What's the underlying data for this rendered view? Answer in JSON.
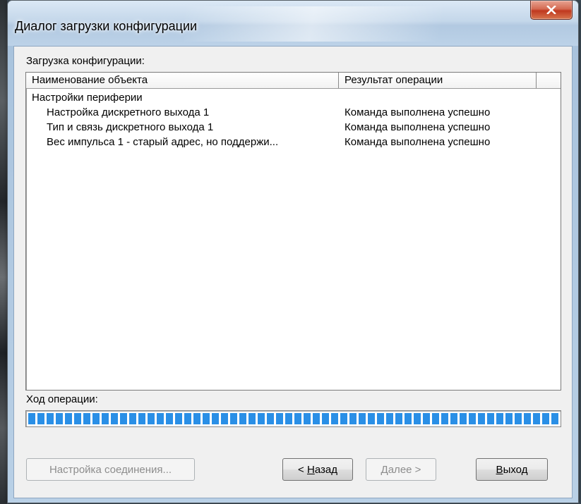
{
  "window": {
    "title": "Диалог загрузки конфигурации"
  },
  "upload_label": "Загрузка конфигурации:",
  "list": {
    "columns": [
      "Наименование объекта",
      "Результат операции",
      ""
    ],
    "rows": [
      {
        "name": "Настройки периферии",
        "result": ""
      },
      {
        "name": "Настройка дискретного выхода 1",
        "result": "Команда выполнена успешно"
      },
      {
        "name": "Тип и связь дискретного выхода 1",
        "result": "Команда выполнена успешно"
      },
      {
        "name": "Вес импульса 1 - старый адрес, но поддержи...",
        "result": "Команда выполнена успешно"
      }
    ]
  },
  "progress_label": "Ход операции:",
  "progress": {
    "value_percent": 100,
    "color": "#2a8fe6"
  },
  "buttons": {
    "connection_settings": "Настройка соединения...",
    "back_prefix": "< ",
    "back_mnemonic": "Н",
    "back_rest": "азад",
    "next_mnemonic": "Д",
    "next_rest": "алее >",
    "exit_mnemonic": "В",
    "exit_rest": "ыход"
  },
  "icons": {
    "close": "close-x-icon"
  }
}
